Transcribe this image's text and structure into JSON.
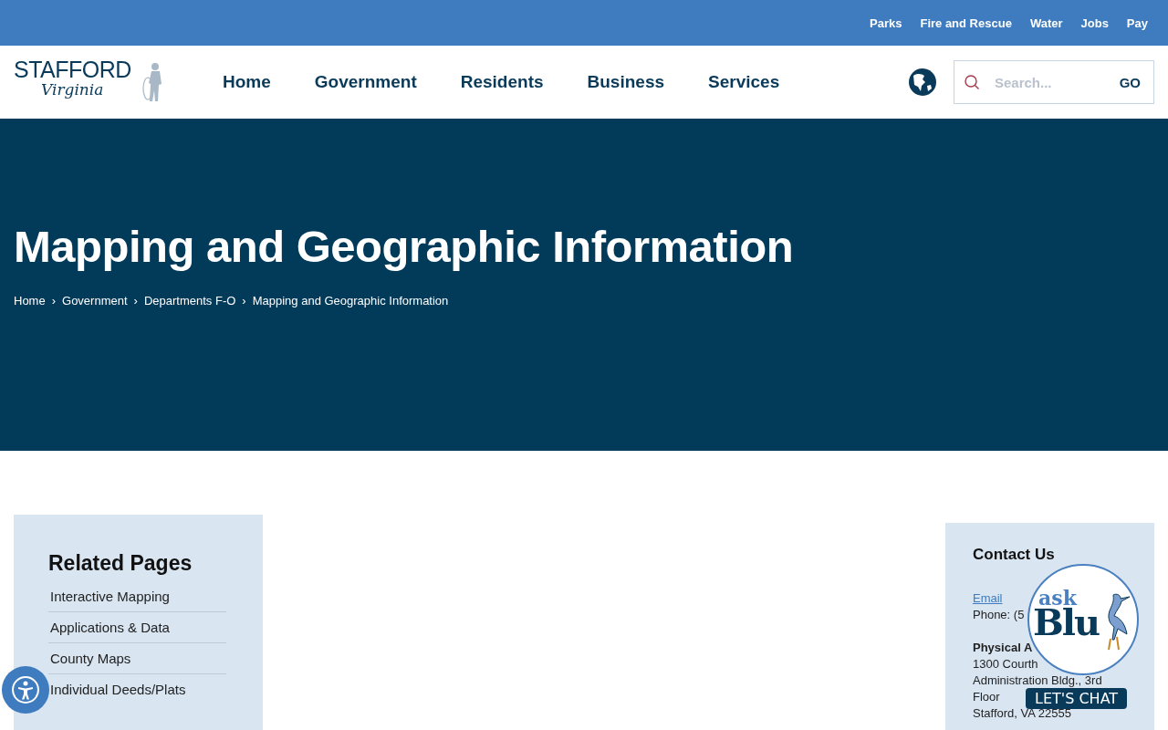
{
  "utility_links": [
    "Parks",
    "Fire and Rescue",
    "Water",
    "Jobs",
    "Pay"
  ],
  "logo": {
    "line1": "STAFFORD",
    "line2": "Virginia"
  },
  "nav": [
    "Home",
    "Government",
    "Residents",
    "Business",
    "Services"
  ],
  "search": {
    "placeholder": "Search...",
    "button": "GO"
  },
  "hero": {
    "title": "Mapping and Geographic Information",
    "breadcrumbs": [
      "Home",
      "Government",
      "Departments F-O",
      "Mapping and Geographic Information"
    ],
    "separator": "›"
  },
  "related": {
    "title": "Related Pages",
    "items": [
      "Interactive Mapping",
      "Applications & Data",
      "County Maps",
      "Individual Deeds/Plats"
    ]
  },
  "contact": {
    "title": "Contact Us",
    "email": "Email",
    "phone": "Phone: (5",
    "address_label": "Physical A",
    "address_lines": [
      "1300 Courth",
      "Administration Bldg., 3rd",
      "Floor",
      "Stafford, VA 22555"
    ]
  },
  "chat": {
    "ask": "ask",
    "name": "Blu",
    "button": "LET'S CHAT"
  }
}
